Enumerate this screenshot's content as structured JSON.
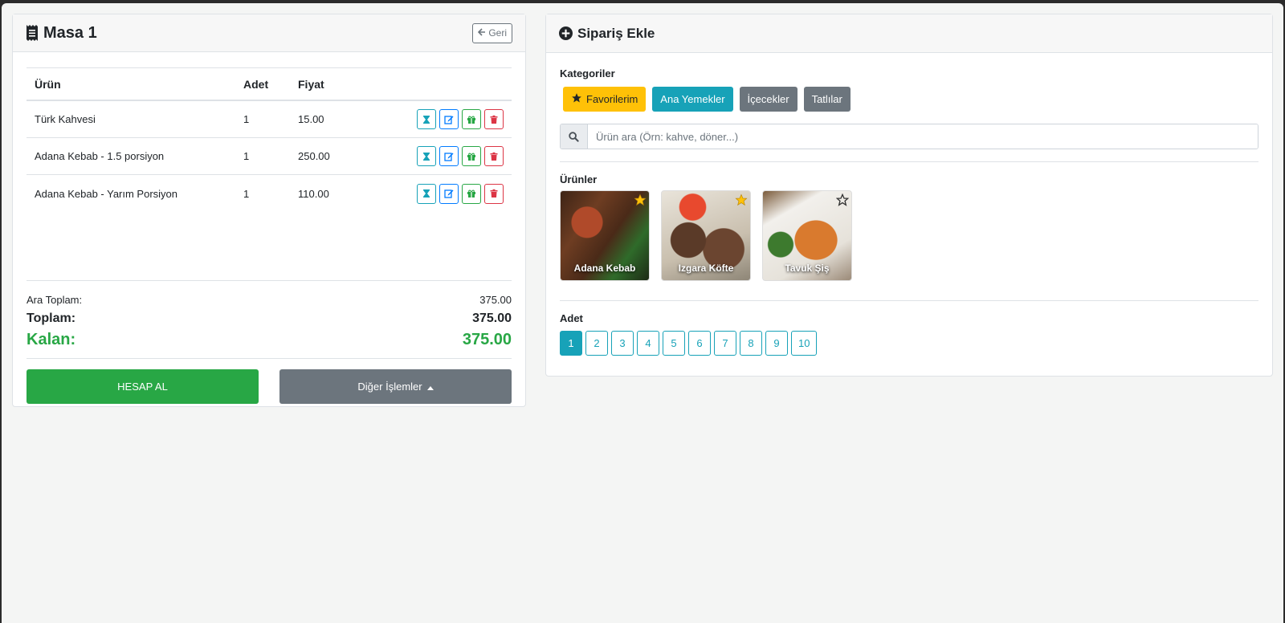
{
  "left": {
    "title": "Masa 1",
    "back_label": "Geri",
    "columns": [
      "Ürün",
      "Adet",
      "Fiyat"
    ],
    "rows": [
      {
        "name": "Türk Kahvesi",
        "qty": "1",
        "price": "15.00"
      },
      {
        "name": "Adana Kebab - 1.5 porsiyon",
        "qty": "1",
        "price": "250.00"
      },
      {
        "name": "Adana Kebab - Yarım Porsiyon",
        "qty": "1",
        "price": "110.00"
      }
    ],
    "subtotal_label": "Ara Toplam:",
    "subtotal": "375.00",
    "total_label": "Toplam:",
    "total": "375.00",
    "remaining_label": "Kalan:",
    "remaining": "375.00",
    "pay_label": "HESAP AL",
    "other_label": "Diğer İşlemler"
  },
  "right": {
    "title": "Sipariş Ekle",
    "categories_label": "Kategoriler",
    "categories": [
      "Favorilerim",
      "Ana Yemekler",
      "İçecekler",
      "Tatlılar"
    ],
    "search_placeholder": "Ürün ara (Örn: kahve, döner...)",
    "products_label": "Ürünler",
    "products": [
      {
        "name": "Adana Kebab",
        "favorite": true
      },
      {
        "name": "Izgara Köfte",
        "favorite": true
      },
      {
        "name": "Tavuk Şiş",
        "favorite": false
      }
    ],
    "qty_label": "Adet",
    "qty_options": [
      "1",
      "2",
      "3",
      "4",
      "5",
      "6",
      "7",
      "8",
      "9",
      "10"
    ],
    "qty_selected": "1"
  },
  "icons": {
    "title_left": "receipt-icon",
    "back": "arrow-left-icon",
    "row_actions": [
      "hourglass-icon",
      "edit-icon",
      "gift-icon",
      "trash-icon"
    ],
    "title_right": "plus-circle-icon",
    "favorites": "star-icon",
    "search": "search-icon",
    "other": "caret-up-icon"
  },
  "colors": {
    "success": "#28a745",
    "info": "#17a2b8",
    "warning": "#ffc107",
    "secondary": "#6c757d",
    "danger": "#dc3545",
    "primary": "#007bff"
  }
}
